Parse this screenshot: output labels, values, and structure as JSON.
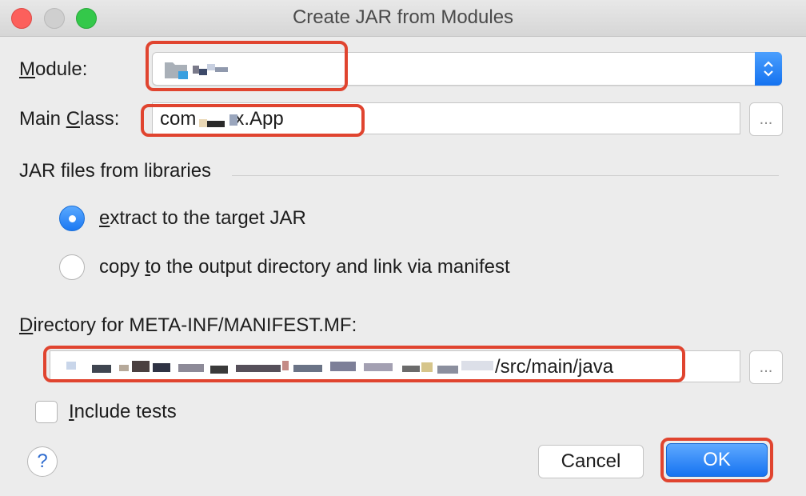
{
  "window": {
    "title": "Create JAR from Modules"
  },
  "module": {
    "label_u": "M",
    "label_rest": "odule:",
    "value": ""
  },
  "main_class": {
    "label_pre": "Main ",
    "label_u": "C",
    "label_rest": "lass:",
    "value": "com  x.App",
    "browse_label": "..."
  },
  "libraries": {
    "section_label": "JAR files from libraries",
    "options": [
      {
        "label_u": "e",
        "label_rest": "xtract to the target JAR",
        "selected": true
      },
      {
        "label_pre": "copy ",
        "label_u": "t",
        "label_rest": "o the output directory and link via manifest",
        "selected": false
      }
    ]
  },
  "manifest_dir": {
    "label_u": "D",
    "label_rest": "irectory for META-INF/MANIFEST.MF:",
    "value_tail": "/src/main/java",
    "browse_label": "..."
  },
  "include_tests": {
    "label_u": "I",
    "label_rest": "nclude tests",
    "checked": false
  },
  "footer": {
    "help_label": "?",
    "cancel_label": "Cancel",
    "ok_label": "OK"
  },
  "colors": {
    "accent": "#1b78f2",
    "highlight": "#e0442f",
    "background": "#ececec"
  }
}
